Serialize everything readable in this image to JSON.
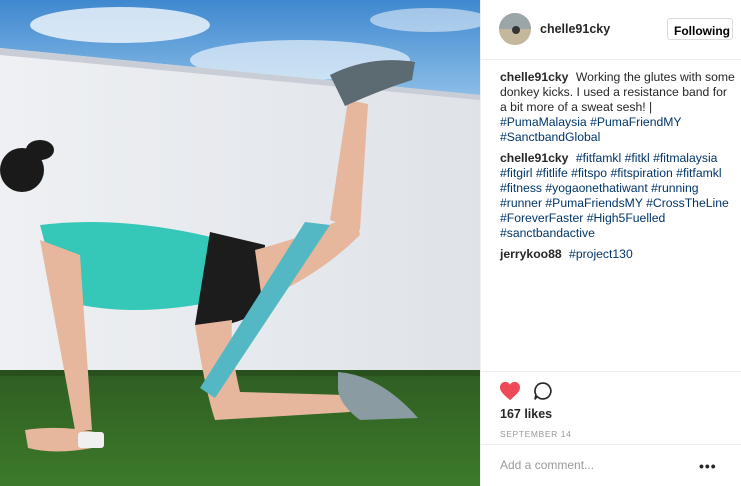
{
  "post": {
    "photo_icon": "photo",
    "username": "chelle91cky",
    "follow_label": "Following"
  },
  "comments": [
    {
      "author": "chelle91cky",
      "text": "Working the glutes with some donkey kicks. I used a resistance band for a bit more of a sweat sesh! |",
      "tags": [
        "#PumaMalaysia",
        "#PumaFriendMY",
        "#SanctbandGlobal"
      ]
    },
    {
      "author": "chelle91cky",
      "text": "",
      "tags": [
        "#fitfamkl",
        "#fitkl",
        "#fitmalaysia",
        "#fitgirl",
        "#fitlife",
        "#fitspo",
        "#fitspiration",
        "#fitfamkl",
        "#fitness",
        "#yogaonethatiwant",
        "#running",
        "#runner",
        "#PumaFriendsMY",
        "#CrossTheLine",
        "#ForeverFaster",
        "#High5Fuelled",
        "#sanctbandactive"
      ]
    },
    {
      "author": "jerrykoo88",
      "text": "",
      "tags": [
        "#project130"
      ]
    }
  ],
  "actions": {
    "like_icon": "heart-filled",
    "like_color": "#ed4956",
    "comment_icon": "speech-bubble",
    "likes": "167 likes",
    "date": "SEPTEMBER 14"
  },
  "comment_bar": {
    "placeholder": "Add a comment...",
    "more_label": "•••"
  },
  "colors": {
    "hashtag": "#003569",
    "border": "#efefef",
    "muted": "#999999"
  }
}
